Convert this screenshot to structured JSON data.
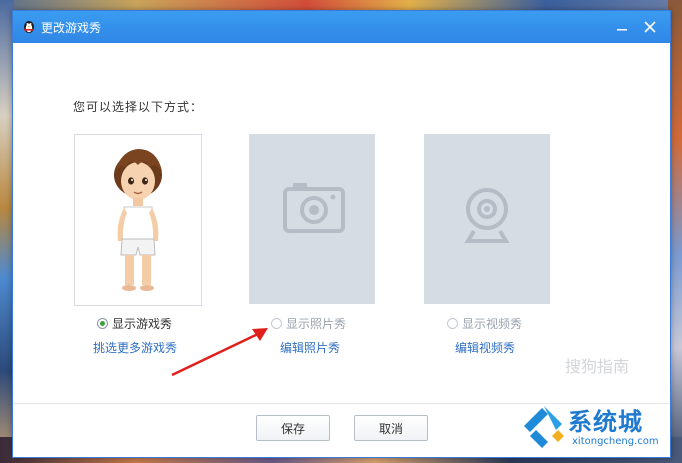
{
  "window": {
    "title": "更改游戏秀",
    "minimize_icon": "minimize-icon",
    "close_icon": "close-icon"
  },
  "prompt": "您可以选择以下方式：",
  "options": [
    {
      "label": "显示游戏秀",
      "link": "挑选更多游戏秀",
      "checked": true,
      "enabled": true,
      "icon": "avatar-image"
    },
    {
      "label": "显示照片秀",
      "link": "编辑照片秀",
      "checked": false,
      "enabled": false,
      "icon": "camera-icon"
    },
    {
      "label": "显示视频秀",
      "link": "编辑视频秀",
      "checked": false,
      "enabled": false,
      "icon": "webcam-icon"
    }
  ],
  "buttons": {
    "save": "保存",
    "cancel": "取消"
  },
  "watermarks": {
    "sogou": "搜狗指南",
    "site_name": "系统城",
    "site_url": "xitongcheng.com"
  },
  "colors": {
    "titlebar": "#2f86e6",
    "link": "#2f6fc4",
    "radio_checked": "#3ca23c",
    "arrow": "#e0201c"
  }
}
